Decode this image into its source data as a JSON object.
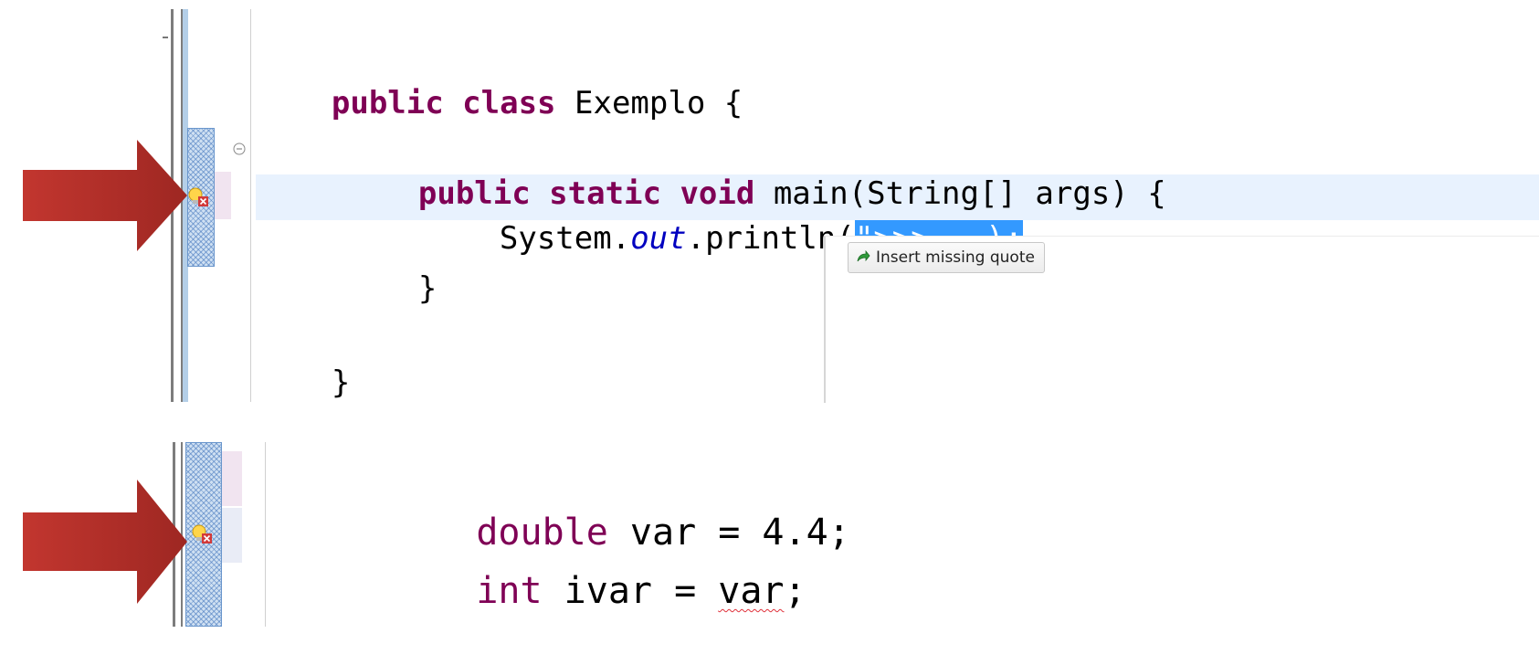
{
  "colors": {
    "keyword": "#7f0055",
    "static_field": "#0000c0",
    "selection": "#3399ff",
    "current_line": "#e8f2fe",
    "error_squiggle": "#e0303a",
    "annotation_arrow": "#b3312c"
  },
  "panel_top": {
    "lines": {
      "class_decl_kw": "public class",
      "class_name": " Exemplo {",
      "method_kw1": "public static void",
      "method_rest": " main(String[] args) {",
      "stmt_prefix": "System.",
      "stmt_field": "out",
      "stmt_call": ".println(",
      "stmt_error": "\">>>...);",
      "close_method": "}",
      "close_class": "}"
    },
    "fold_icon": "collapse-circle-icon",
    "error_marker_icon": "lightbulb-error-icon",
    "quick_fix": {
      "icon": "green-arrow-quickfix-icon",
      "label": "Insert missing quote"
    }
  },
  "panel_bottom": {
    "lines": {
      "line1_kw": "double",
      "line1_rest": " var = 4.4;",
      "line2_kw": "int",
      "line2_mid": " ivar = ",
      "line2_error": "var",
      "line2_end": ";"
    },
    "error_marker_icon": "lightbulb-error-icon"
  }
}
